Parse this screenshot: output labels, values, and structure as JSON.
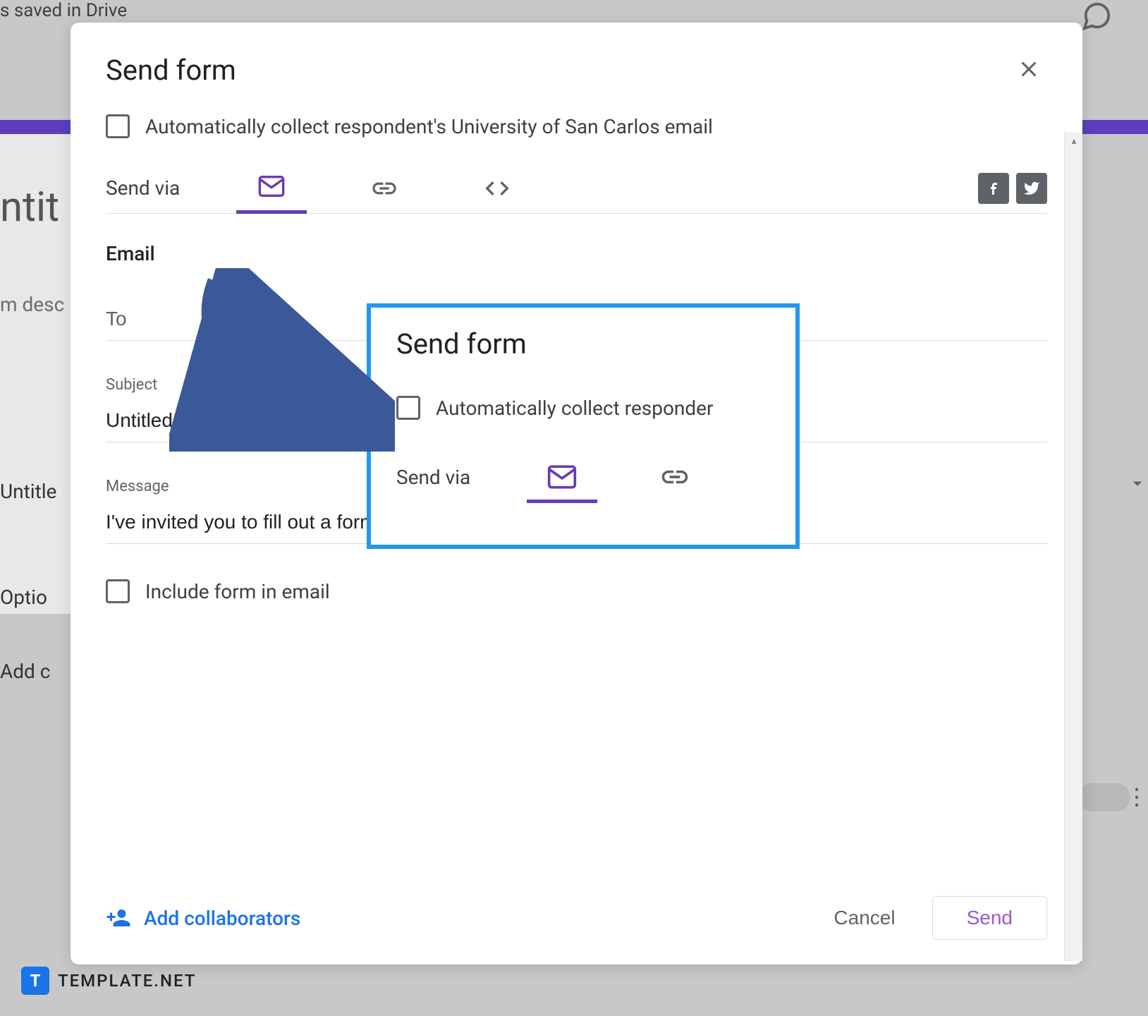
{
  "background": {
    "saved_text": "s saved in Drive",
    "title_fragment": "ntit",
    "desc_fragment": "m desc",
    "untitle_fragment": "Untitle",
    "optio_fragment": "Optio",
    "addc_fragment": "Add c"
  },
  "dialog": {
    "title": "Send form",
    "collect_email_label": "Automatically collect respondent's University of San Carlos email",
    "send_via_label": "Send via",
    "email_section": "Email",
    "to_label": "To",
    "subject_label": "Subject",
    "subject_value": "Untitled form",
    "message_label": "Message",
    "message_value": "I've invited you to fill out a form:",
    "include_form_label": "Include form in email",
    "add_collaborators": "Add collaborators",
    "cancel_label": "Cancel",
    "send_label": "Send"
  },
  "callout": {
    "title": "Send form",
    "checkbox_label": "Automatically collect responder",
    "send_via_label": "Send via"
  },
  "watermark": {
    "icon_letter": "T",
    "text": "TEMPLATE.NET"
  }
}
